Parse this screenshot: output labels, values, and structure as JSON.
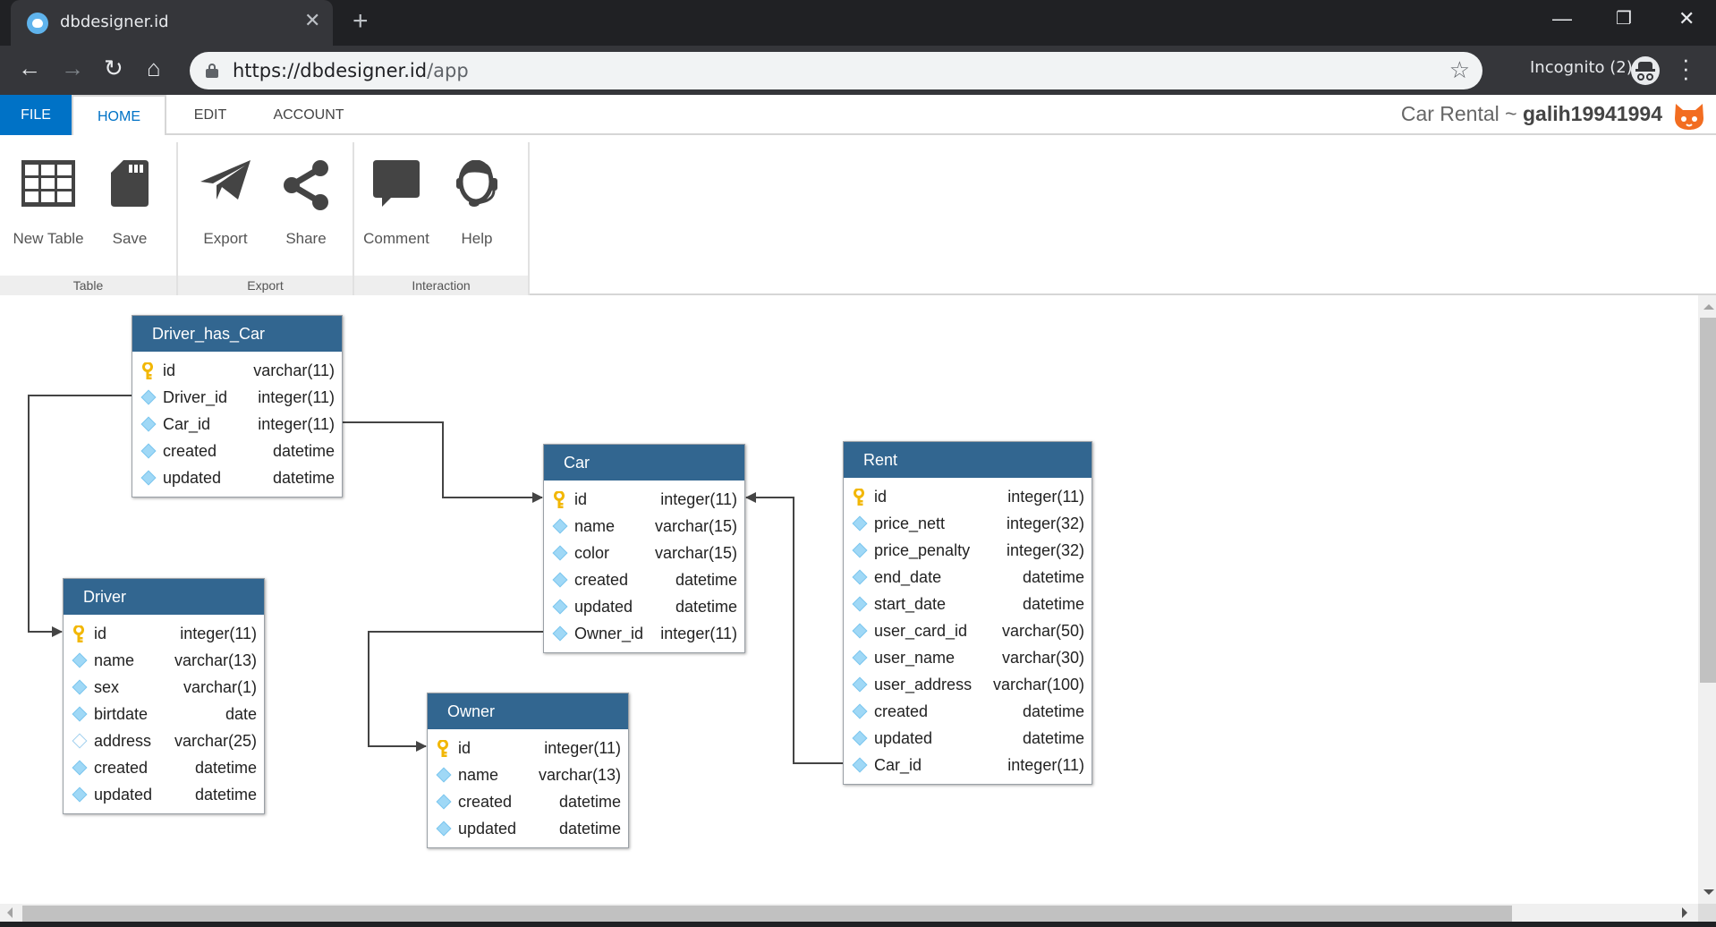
{
  "browser": {
    "tab_title": "dbdesigner.id",
    "new_tab_icon": "plus-icon",
    "url_host": "https://dbdesigner.id",
    "url_path": "/app",
    "incognito_label": "Incognito (2)",
    "window_controls": [
      "minimize-icon",
      "restore-icon",
      "close-icon"
    ]
  },
  "menu": {
    "tabs": [
      {
        "label": "FILE"
      },
      {
        "label": "HOME"
      },
      {
        "label": "EDIT"
      },
      {
        "label": "ACCOUNT"
      }
    ],
    "active": "HOME",
    "project_name": "Car Rental",
    "separator": "~",
    "username": "galih19941994"
  },
  "ribbon": {
    "groups": [
      {
        "label": "Table",
        "buttons": [
          {
            "label": "New Table",
            "icon": "table-grid-icon"
          },
          {
            "label": "Save",
            "icon": "sd-card-icon"
          }
        ]
      },
      {
        "label": "Export",
        "buttons": [
          {
            "label": "Export",
            "icon": "paper-plane-icon"
          },
          {
            "label": "Share",
            "icon": "share-icon"
          }
        ]
      },
      {
        "label": "Interaction",
        "buttons": [
          {
            "label": "Comment",
            "icon": "comment-icon"
          },
          {
            "label": "Help",
            "icon": "headset-icon"
          }
        ]
      }
    ]
  },
  "colors": {
    "header_blue": "#326690",
    "file_tab_blue": "#0072c6",
    "key_yellow": "#f2b705",
    "field_diamond": "#9fd8f6",
    "mascot_orange": "#f26d21"
  },
  "tables": {
    "driver_has_car": {
      "name": "Driver_has_Car",
      "fields": [
        {
          "name": "id",
          "type": "varchar(11)",
          "kind": "primary-key"
        },
        {
          "name": "Driver_id",
          "type": "integer(11)",
          "kind": "field"
        },
        {
          "name": "Car_id",
          "type": "integer(11)",
          "kind": "field"
        },
        {
          "name": "created",
          "type": "datetime",
          "kind": "field"
        },
        {
          "name": "updated",
          "type": "datetime",
          "kind": "field"
        }
      ]
    },
    "car": {
      "name": "Car",
      "fields": [
        {
          "name": "id",
          "type": "integer(11)",
          "kind": "primary-key"
        },
        {
          "name": "name",
          "type": "varchar(15)",
          "kind": "field"
        },
        {
          "name": "color",
          "type": "varchar(15)",
          "kind": "field"
        },
        {
          "name": "created",
          "type": "datetime",
          "kind": "field"
        },
        {
          "name": "updated",
          "type": "datetime",
          "kind": "field"
        },
        {
          "name": "Owner_id",
          "type": "integer(11)",
          "kind": "field"
        }
      ]
    },
    "rent": {
      "name": "Rent",
      "fields": [
        {
          "name": "id",
          "type": "integer(11)",
          "kind": "primary-key"
        },
        {
          "name": "price_nett",
          "type": "integer(32)",
          "kind": "field"
        },
        {
          "name": "price_penalty",
          "type": "integer(32)",
          "kind": "field"
        },
        {
          "name": "end_date",
          "type": "datetime",
          "kind": "field"
        },
        {
          "name": "start_date",
          "type": "datetime",
          "kind": "field"
        },
        {
          "name": "user_card_id",
          "type": "varchar(50)",
          "kind": "field"
        },
        {
          "name": "user_name",
          "type": "varchar(30)",
          "kind": "field"
        },
        {
          "name": "user_address",
          "type": "varchar(100)",
          "kind": "field"
        },
        {
          "name": "created",
          "type": "datetime",
          "kind": "field"
        },
        {
          "name": "updated",
          "type": "datetime",
          "kind": "field"
        },
        {
          "name": "Car_id",
          "type": "integer(11)",
          "kind": "field"
        }
      ]
    },
    "driver": {
      "name": "Driver",
      "fields": [
        {
          "name": "id",
          "type": "integer(11)",
          "kind": "primary-key"
        },
        {
          "name": "name",
          "type": "varchar(13)",
          "kind": "field"
        },
        {
          "name": "sex",
          "type": "varchar(1)",
          "kind": "field"
        },
        {
          "name": "birtdate",
          "type": "date",
          "kind": "field"
        },
        {
          "name": "address",
          "type": "varchar(25)",
          "kind": "nullable-field"
        },
        {
          "name": "created",
          "type": "datetime",
          "kind": "field"
        },
        {
          "name": "updated",
          "type": "datetime",
          "kind": "field"
        }
      ]
    },
    "owner": {
      "name": "Owner",
      "fields": [
        {
          "name": "id",
          "type": "integer(11)",
          "kind": "primary-key"
        },
        {
          "name": "name",
          "type": "varchar(13)",
          "kind": "field"
        },
        {
          "name": "created",
          "type": "datetime",
          "kind": "field"
        },
        {
          "name": "updated",
          "type": "datetime",
          "kind": "field"
        }
      ]
    }
  },
  "relations": [
    {
      "from": "Driver_has_Car.Driver_id",
      "to": "Driver.id"
    },
    {
      "from": "Driver_has_Car.Car_id",
      "to": "Car.id"
    },
    {
      "from": "Car.Owner_id",
      "to": "Owner.id"
    },
    {
      "from": "Rent.Car_id",
      "to": "Car.id"
    }
  ]
}
